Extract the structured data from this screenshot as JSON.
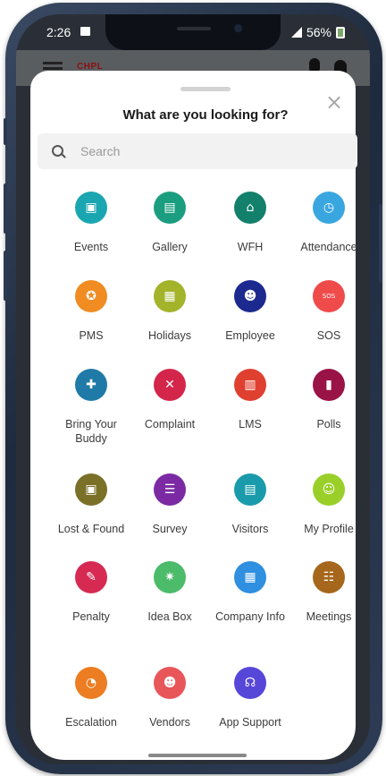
{
  "status_bar": {
    "time": "2:26",
    "battery": "56%"
  },
  "app_header": {
    "brand": "CHPL"
  },
  "sheet": {
    "title": "What are you looking for?",
    "search": {
      "placeholder": "Search",
      "value": ""
    }
  },
  "tiles": [
    {
      "label": "Events",
      "icon": "calendar-icon",
      "glyph": "▣",
      "color": "#1aa6b0"
    },
    {
      "label": "Gallery",
      "icon": "gallery-icon",
      "glyph": "▤",
      "color": "#1b9e7f"
    },
    {
      "label": "WFH",
      "icon": "home-icon",
      "glyph": "⌂",
      "color": "#12806b"
    },
    {
      "label": "Attendance",
      "icon": "attendance-icon",
      "glyph": "◷",
      "color": "#3aa6e0"
    },
    {
      "label": "PMS",
      "icon": "pms-icon",
      "glyph": "✪",
      "color": "#f08c22"
    },
    {
      "label": "Holidays",
      "icon": "holidays-icon",
      "glyph": "▦",
      "color": "#a3b32a"
    },
    {
      "label": "Employee",
      "icon": "employee-icon",
      "glyph": "☻",
      "color": "#1c2a8f"
    },
    {
      "label": "SOS",
      "icon": "sos-icon",
      "glyph": "SOS",
      "color": "#ef4b4b"
    },
    {
      "label": "Bring Your Buddy",
      "icon": "buddy-icon",
      "glyph": "✚",
      "color": "#1f7aa8"
    },
    {
      "label": "Complaint",
      "icon": "tools-icon",
      "glyph": "✕",
      "color": "#d3264a"
    },
    {
      "label": "LMS",
      "icon": "lms-icon",
      "glyph": "▥",
      "color": "#e0402f"
    },
    {
      "label": "Polls",
      "icon": "polls-icon",
      "glyph": "▮",
      "color": "#9a1347"
    },
    {
      "label": "Lost & Found",
      "icon": "lost-found-icon",
      "glyph": "▣",
      "color": "#7b7028"
    },
    {
      "label": "Survey",
      "icon": "survey-icon",
      "glyph": "☰",
      "color": "#7b2aa4"
    },
    {
      "label": "Visitors",
      "icon": "visitors-icon",
      "glyph": "▤",
      "color": "#1a9bab"
    },
    {
      "label": "My Profile",
      "icon": "profile-icon",
      "glyph": "☺",
      "color": "#9acf2a"
    },
    {
      "label": "Penalty",
      "icon": "penalty-icon",
      "glyph": "✎",
      "color": "#d62a52"
    },
    {
      "label": "Idea Box",
      "icon": "idea-box-icon",
      "glyph": "✷",
      "color": "#4cbb6a"
    },
    {
      "label": "Company Info",
      "icon": "building-icon",
      "glyph": "▦",
      "color": "#2f8fe0"
    },
    {
      "label": "Meetings",
      "icon": "meetings-icon",
      "glyph": "☷",
      "color": "#a6661c"
    },
    {
      "label": "Escalation",
      "icon": "escalation-icon",
      "glyph": "◔",
      "color": "#ec7d22"
    },
    {
      "label": "Vendors",
      "icon": "vendors-icon",
      "glyph": "☻",
      "color": "#e8565a"
    },
    {
      "label": "App Support",
      "icon": "headset-icon",
      "glyph": "☊",
      "color": "#5747d8"
    }
  ]
}
